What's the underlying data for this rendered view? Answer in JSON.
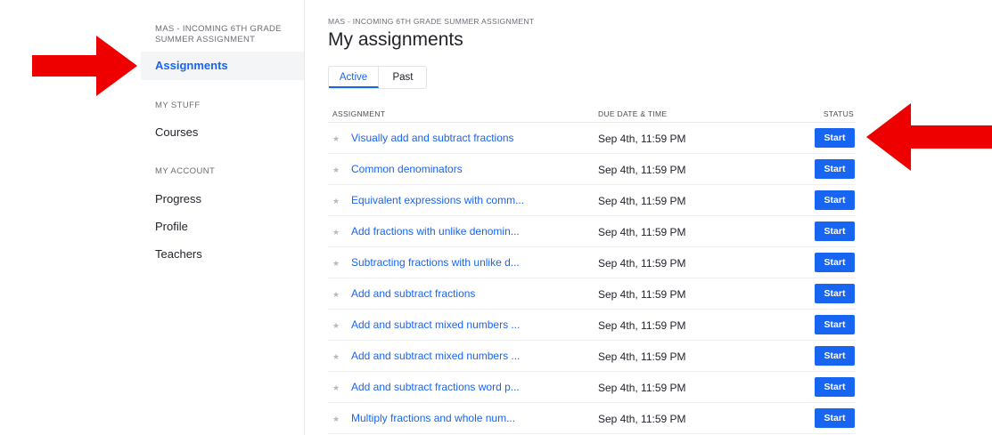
{
  "sidebar": {
    "class_name": "MAS - INCOMING 6TH GRADE SUMMER ASSIGNMENT",
    "active_item": "Assignments",
    "my_stuff_heading": "MY STUFF",
    "courses": "Courses",
    "my_account_heading": "MY ACCOUNT",
    "progress": "Progress",
    "profile": "Profile",
    "teachers": "Teachers"
  },
  "main": {
    "breadcrumb": "MAS - INCOMING 6TH GRADE SUMMER ASSIGNMENT",
    "title": "My assignments",
    "tabs": [
      "Active",
      "Past"
    ],
    "columns": {
      "assignment": "ASSIGNMENT",
      "due": "DUE DATE & TIME",
      "status": "STATUS"
    },
    "rows": [
      {
        "name": "Visually add and subtract fractions",
        "due": "Sep 4th, 11:59 PM",
        "status": "Start"
      },
      {
        "name": "Common denominators",
        "due": "Sep 4th, 11:59 PM",
        "status": "Start"
      },
      {
        "name": "Equivalent expressions with comm...",
        "due": "Sep 4th, 11:59 PM",
        "status": "Start"
      },
      {
        "name": "Add fractions with unlike denomin...",
        "due": "Sep 4th, 11:59 PM",
        "status": "Start"
      },
      {
        "name": "Subtracting fractions with unlike d...",
        "due": "Sep 4th, 11:59 PM",
        "status": "Start"
      },
      {
        "name": "Add and subtract fractions",
        "due": "Sep 4th, 11:59 PM",
        "status": "Start"
      },
      {
        "name": "Add and subtract mixed numbers ...",
        "due": "Sep 4th, 11:59 PM",
        "status": "Start"
      },
      {
        "name": "Add and subtract mixed numbers ...",
        "due": "Sep 4th, 11:59 PM",
        "status": "Start"
      },
      {
        "name": "Add and subtract fractions word p...",
        "due": "Sep 4th, 11:59 PM",
        "status": "Start"
      },
      {
        "name": "Multiply fractions and whole num...",
        "due": "Sep 4th, 11:59 PM",
        "status": "Start"
      }
    ]
  },
  "annotations": {
    "arrow_color": "#ee0000",
    "left_arrow_icon": "arrow-right-icon",
    "right_arrow_icon": "arrow-left-icon"
  },
  "colors": {
    "accent": "#1865f2",
    "button_text": "#ffffff"
  }
}
